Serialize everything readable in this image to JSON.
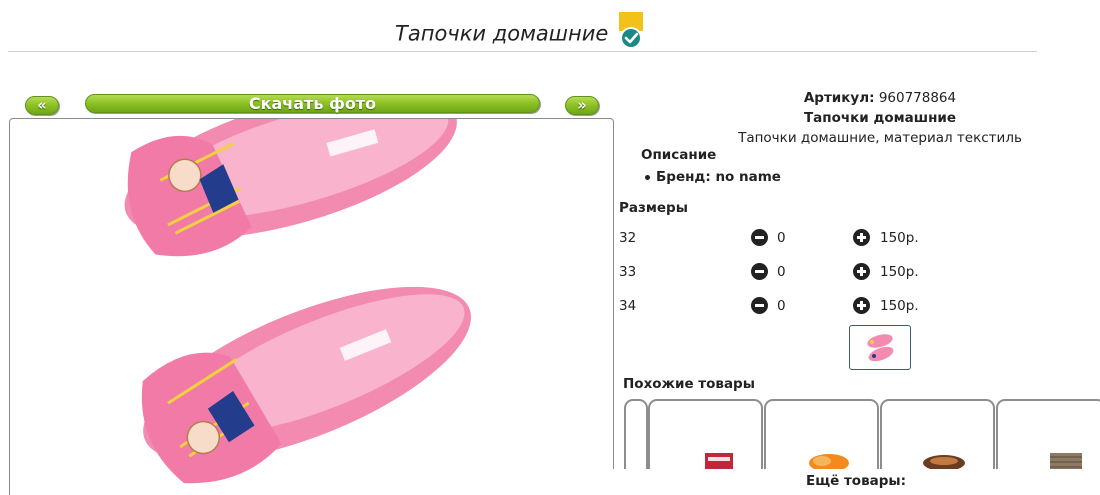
{
  "product": {
    "title": "Тапочки домашние",
    "article_label": "Артикул:",
    "article_value": "960778864",
    "name": "Тапочки домашние",
    "subtitle": "Тапочки домашние, материал текстиль"
  },
  "gallery": {
    "prev_label": "«",
    "next_label": "»",
    "download_label": "Скачать фото"
  },
  "description": {
    "heading": "Описание",
    "brand": "Бренд: no name"
  },
  "sizes": {
    "heading": "Размеры",
    "rows": [
      {
        "size": "32",
        "qty": "0",
        "price": "150р."
      },
      {
        "size": "33",
        "qty": "0",
        "price": "150р."
      },
      {
        "size": "34",
        "qty": "0",
        "price": "150р."
      }
    ]
  },
  "similar": {
    "heading": "Похожие товары",
    "more_label": "Ещё товары:"
  },
  "icons": {
    "verified": "verified-badge-icon",
    "minus": "minus-circle-icon",
    "plus": "plus-circle-icon"
  },
  "colors": {
    "accent_green": "#8cc022",
    "badge_teal": "#1b8a86",
    "badge_yellow": "#f2c21a",
    "slipper_pink": "#f58fb3"
  }
}
